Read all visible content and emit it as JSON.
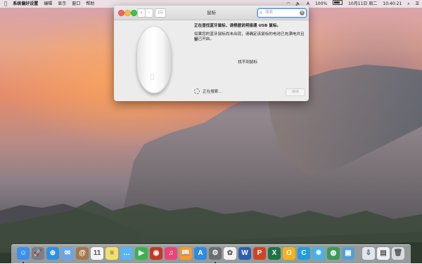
{
  "menubar": {
    "apple_icon": "apple-icon",
    "app_name": "系统偏好设置",
    "items": [
      "编辑",
      "显示",
      "窗口",
      "帮助"
    ],
    "status": {
      "battery_percent": "100%",
      "date_time": "10月11日 周二",
      "time": "10:40:21"
    }
  },
  "window": {
    "title": "鼠标",
    "search_placeholder": "搜索",
    "heading": "正在查找蓝牙鼠标，请根据说明接通 USB 鼠标。",
    "line1": "如果您的蓝牙鼠标尚未出现，请确定该鼠标的电池已充满电并且鼠",
    "line2": "标已开启。",
    "not_found": "找不到鼠标",
    "searching": "正在搜索…",
    "continue_label": "继续"
  },
  "dock": {
    "apps": [
      {
        "name": "finder-icon",
        "color": "#3b8ff0",
        "glyph": "☺"
      },
      {
        "name": "launchpad-icon",
        "color": "#7a7f8a",
        "glyph": "🚀"
      },
      {
        "name": "safari-icon",
        "color": "#2f8fe6",
        "glyph": "⊕"
      },
      {
        "name": "mail-icon",
        "color": "#6aa5e8",
        "glyph": "✉"
      },
      {
        "name": "contacts-icon",
        "color": "#a5774c",
        "glyph": "@"
      },
      {
        "name": "calendar-icon",
        "color": "#f4f4f4",
        "glyph": "11"
      },
      {
        "name": "notes-icon",
        "color": "#f3df6a",
        "glyph": "≡"
      },
      {
        "name": "messages-icon",
        "color": "#5ab4f5",
        "glyph": "…"
      },
      {
        "name": "facetime-icon",
        "color": "#3bb24d",
        "glyph": "▶"
      },
      {
        "name": "photo-booth-icon",
        "color": "#c0392b",
        "glyph": "◉"
      },
      {
        "name": "itunes-icon",
        "color": "#e8457a",
        "glyph": "♫"
      },
      {
        "name": "ibooks-icon",
        "color": "#f59a2a",
        "glyph": "📖"
      },
      {
        "name": "app-store-icon",
        "color": "#2b8be6",
        "glyph": "A"
      },
      {
        "name": "system-preferences-icon",
        "color": "#6b6e73",
        "glyph": "⚙"
      },
      {
        "name": "photos-icon",
        "color": "#f2f2f2",
        "glyph": "✿"
      },
      {
        "name": "word-icon",
        "color": "#2b5fb4",
        "glyph": "W"
      },
      {
        "name": "powerpoint-icon",
        "color": "#d04423",
        "glyph": "P"
      },
      {
        "name": "excel-icon",
        "color": "#207245",
        "glyph": "X"
      },
      {
        "name": "qq-browser-icon",
        "color": "#f5b21d",
        "glyph": "O"
      },
      {
        "name": "c-app-icon",
        "color": "#1f9ce0",
        "glyph": "C"
      },
      {
        "name": "wechat-icon",
        "color": "#46b3e6",
        "glyph": "❋"
      },
      {
        "name": "globe-app-icon",
        "color": "#3a9a56",
        "glyph": "◍"
      },
      {
        "name": "preview-icon",
        "color": "#4fa0d8",
        "glyph": "▣"
      },
      {
        "name": "downloads-folder-icon",
        "color": "#dfe6ee",
        "glyph": "⇩"
      },
      {
        "name": "documents-folder-icon",
        "color": "#eef2f6",
        "glyph": "▤"
      },
      {
        "name": "trash-icon",
        "color": "#d8dce0",
        "glyph": "🗑"
      }
    ]
  }
}
